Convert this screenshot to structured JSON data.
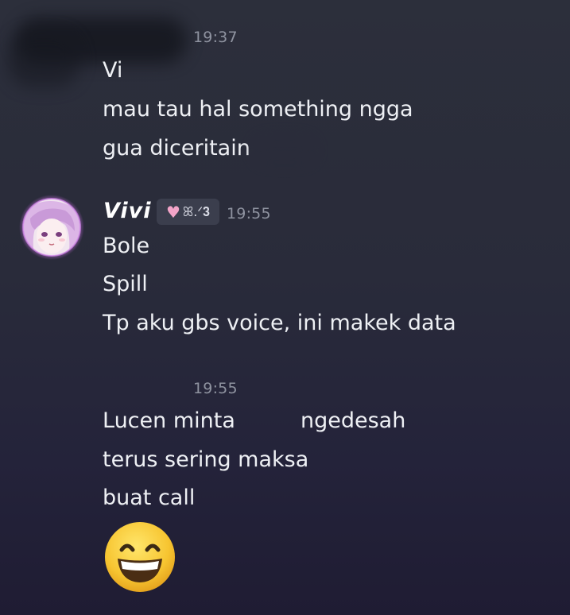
{
  "messages": [
    {
      "timestamp": "19:37",
      "lines": [
        "Vi",
        "mau tau hal something ngga",
        "gua diceritain"
      ]
    },
    {
      "username": "Vivi",
      "badge_text": "ꕤ.ᐟ𝟑",
      "timestamp": "19:55",
      "lines": [
        "Bole",
        "Spill",
        "Tp aku gbs voice, ini makek data"
      ]
    },
    {
      "timestamp": "19:55",
      "lines": [
        "Lucen minta",
        "ngedesah",
        "terus sering maksa",
        "buat call"
      ]
    }
  ],
  "emoji": {
    "icon": "grinning-face-with-smiling-eyes"
  },
  "colors": {
    "text": "#eef0f4",
    "timestamp": "#8f93a0",
    "background_top": "#2c2f3b",
    "background_bottom": "#1f1c33",
    "badge_bg": "#3b3e4d"
  }
}
